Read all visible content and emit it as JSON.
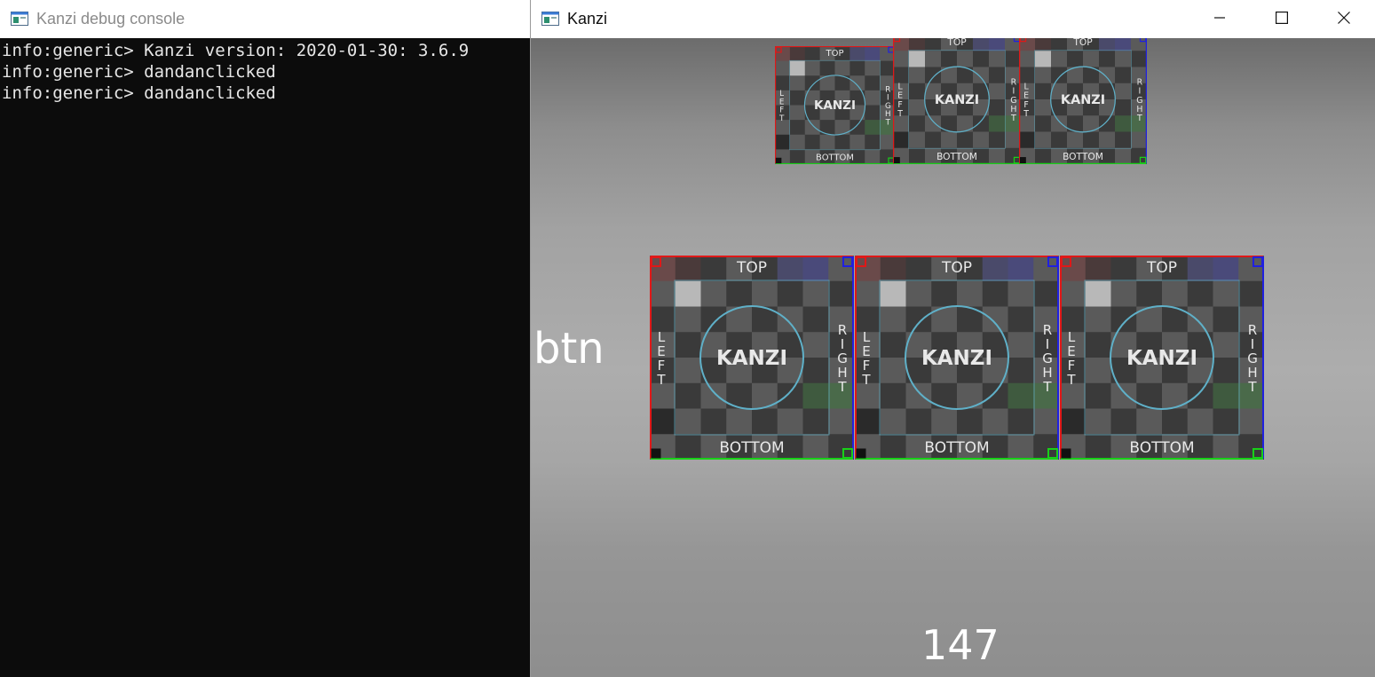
{
  "console_window": {
    "title": "Kanzi debug console",
    "lines": [
      "info:generic> Kanzi version: 2020-01-30: 3.6.9",
      "info:generic> dandanclicked",
      "info:generic> dandanclicked"
    ]
  },
  "kanzi_window": {
    "title": "Kanzi",
    "controls": {
      "minimize": "minimize-icon",
      "maximize": "maximize-icon",
      "close": "close-icon"
    },
    "btn_label": "btn",
    "counter": "147",
    "tile": {
      "top": "TOP",
      "bottom": "BOTTOM",
      "left": "LEFT",
      "right": "RIGHT",
      "logo": "KANZI"
    },
    "colors": {
      "console_bg": "#0c0c0c",
      "console_text": "#e6e6e6",
      "tile_circle": "#5fb0c8",
      "corner_red": "#e01818",
      "corner_blue": "#2020e0",
      "corner_green": "#18d018"
    }
  }
}
